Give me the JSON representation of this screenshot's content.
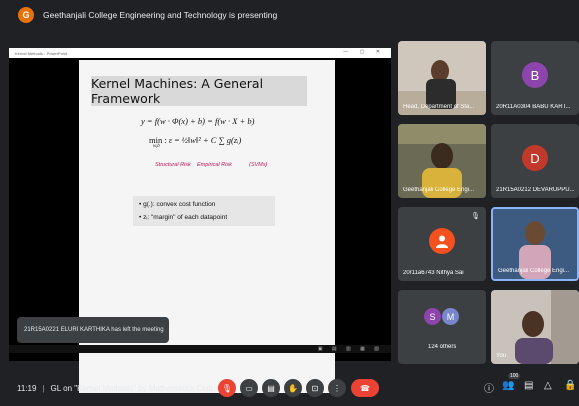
{
  "topbar": {
    "avatar_letter": "G",
    "presenting_text": "Geethanjali College Engineering and Technology is presenting"
  },
  "presentation": {
    "window_title": "Kernel Methods - PowerPoint",
    "slide": {
      "title": "Kernel Machines: A General Framework",
      "eq1": "y = f(w · Φ(x) + b) = f(w · X + b)",
      "eq2_label": "min : ε = ",
      "eq2_rest": "½‖w‖² + C ∑ g(zᵢ)",
      "eq2_sub": "w,b",
      "risk_structural": "Structural Risk",
      "risk_empirical": "Empirical Risk",
      "risk_svm": "(SVMs)",
      "bullets": [
        "g(.): convex cost function",
        "zᵢ: \"margin\" of each datapoint"
      ]
    }
  },
  "notification": "21R15A0221 ELURI KARTHIKA has left the meeting",
  "participants": [
    {
      "name": "Head, Department of Sta...",
      "type": "video"
    },
    {
      "name": "20R11A0304 BABU KART...",
      "type": "avatar",
      "letter": "B",
      "color": "#8e44ad"
    },
    {
      "name": "Geethanjali College Engi...",
      "type": "video"
    },
    {
      "name": "21R15A0212 DEVARUPPU...",
      "type": "avatar",
      "letter": "D",
      "color": "#c0392b"
    },
    {
      "name": "20r11a6743 Nithya Sai",
      "type": "person-icon"
    },
    {
      "name": "Geethanjali College Engi...",
      "type": "video-active"
    },
    {
      "name": "124 others",
      "type": "others",
      "letters": [
        "S",
        "M"
      ]
    },
    {
      "name": "You",
      "type": "video"
    }
  ],
  "bottombar": {
    "time": "11:19",
    "separator": "|",
    "meeting_title": "GL on \"Kernel Methods\" by Mathematics Club",
    "participant_count": "100"
  },
  "colors": {
    "background": "#202124",
    "tile": "#3c4043",
    "danger": "#ea4335",
    "accent": "#8ab4f8"
  }
}
